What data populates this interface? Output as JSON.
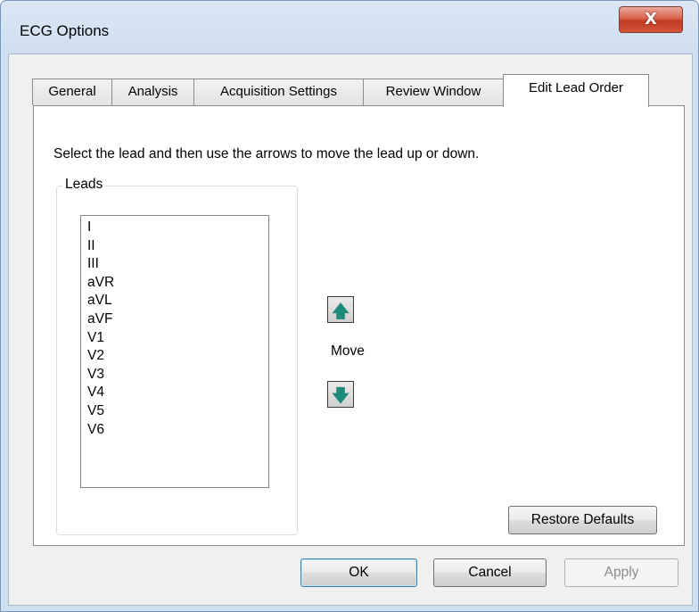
{
  "window": {
    "title": "ECG Options",
    "close_label": "X"
  },
  "tabs": [
    {
      "label": "General"
    },
    {
      "label": "Analysis"
    },
    {
      "label": "Acquisition Settings"
    },
    {
      "label": "Review Window"
    },
    {
      "label": "Edit Lead Order",
      "active": true
    }
  ],
  "panel": {
    "instructions": "Select the lead and then use the arrows to move the lead up or down.",
    "group_label": "Leads",
    "leads": [
      "I",
      "II",
      "III",
      "aVR",
      "aVL",
      "aVF",
      "V1",
      "V2",
      "V3",
      "V4",
      "V5",
      "V6"
    ],
    "move_label": "Move",
    "up_icon": "up-arrow-icon",
    "down_icon": "down-arrow-icon",
    "restore_defaults_label": "Restore Defaults"
  },
  "buttons": {
    "ok": "OK",
    "cancel": "Cancel",
    "apply": "Apply"
  }
}
